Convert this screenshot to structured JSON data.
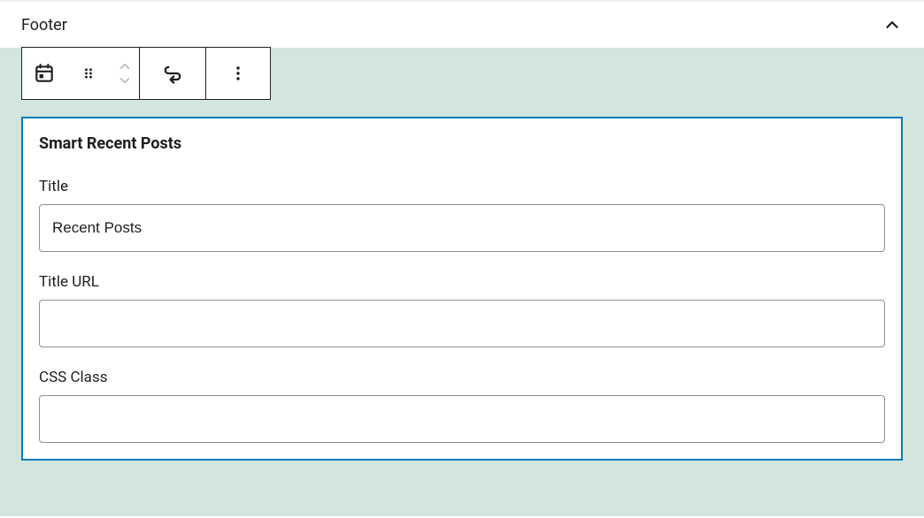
{
  "panel": {
    "title": "Footer"
  },
  "toolbar": {
    "block_icon_name": "calendar-icon",
    "drag_icon_name": "drag-handle-icon",
    "move_up_name": "move-up-icon",
    "move_down_name": "move-down-icon",
    "undo_name": "change-tool-icon",
    "more_name": "more-options-icon"
  },
  "block": {
    "heading": "Smart Recent Posts",
    "fields": {
      "title": {
        "label": "Title",
        "value": "Recent Posts"
      },
      "title_url": {
        "label": "Title URL",
        "value": ""
      },
      "css_class": {
        "label": "CSS Class",
        "value": ""
      }
    }
  }
}
